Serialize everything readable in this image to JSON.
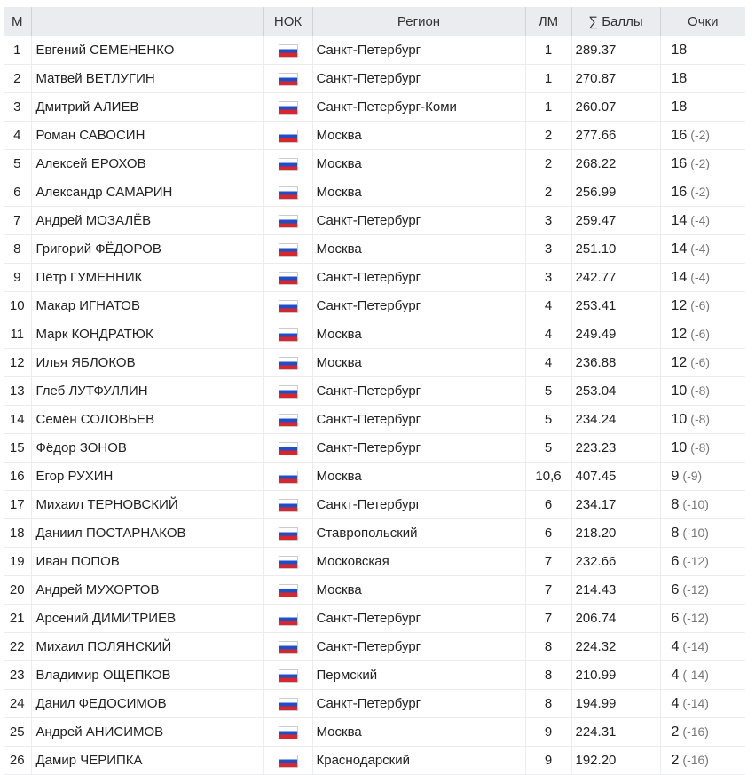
{
  "table": {
    "headers": {
      "m": "М",
      "name": "",
      "noc": "НОК",
      "region": "Регион",
      "lm": "ЛМ",
      "sum": "∑ Баллы",
      "pts": "Очки"
    },
    "flag_icon": "russia-flag-icon",
    "colors": {
      "header_bg": "#eaecf0",
      "flag_white": "#ffffff",
      "flag_blue": "#1f4fc7",
      "flag_red": "#d8262c",
      "delta_text": "#777777"
    },
    "rows": [
      {
        "m": "1",
        "name": "Евгений СЕМЕНЕНКО",
        "region": "Санкт-Петербург",
        "lm": "1",
        "sum": "289.37",
        "pts": "18",
        "delta": ""
      },
      {
        "m": "2",
        "name": "Матвей ВЕТЛУГИН",
        "region": "Санкт-Петербург",
        "lm": "1",
        "sum": "270.87",
        "pts": "18",
        "delta": ""
      },
      {
        "m": "3",
        "name": "Дмитрий АЛИЕВ",
        "region": "Санкт-Петербург-Коми",
        "lm": "1",
        "sum": "260.07",
        "pts": "18",
        "delta": ""
      },
      {
        "m": "4",
        "name": "Роман САВОСИН",
        "region": "Москва",
        "lm": "2",
        "sum": "277.66",
        "pts": "16",
        "delta": "(-2)"
      },
      {
        "m": "5",
        "name": "Алексей ЕРОХОВ",
        "region": "Москва",
        "lm": "2",
        "sum": "268.22",
        "pts": "16",
        "delta": "(-2)"
      },
      {
        "m": "6",
        "name": "Александр САМАРИН",
        "region": "Москва",
        "lm": "2",
        "sum": "256.99",
        "pts": "16",
        "delta": "(-2)"
      },
      {
        "m": "7",
        "name": "Андрей МОЗАЛЁВ",
        "region": "Санкт-Петербург",
        "lm": "3",
        "sum": "259.47",
        "pts": "14",
        "delta": "(-4)"
      },
      {
        "m": "8",
        "name": "Григорий ФЁДОРОВ",
        "region": "Москва",
        "lm": "3",
        "sum": "251.10",
        "pts": "14",
        "delta": "(-4)"
      },
      {
        "m": "9",
        "name": "Пётр ГУМЕННИК",
        "region": "Санкт-Петербург",
        "lm": "3",
        "sum": "242.77",
        "pts": "14",
        "delta": "(-4)"
      },
      {
        "m": "10",
        "name": "Макар ИГНАТОВ",
        "region": "Санкт-Петербург",
        "lm": "4",
        "sum": "253.41",
        "pts": "12",
        "delta": "(-6)"
      },
      {
        "m": "11",
        "name": "Марк КОНДРАТЮК",
        "region": "Москва",
        "lm": "4",
        "sum": "249.49",
        "pts": "12",
        "delta": "(-6)"
      },
      {
        "m": "12",
        "name": "Илья ЯБЛОКОВ",
        "region": "Москва",
        "lm": "4",
        "sum": "236.88",
        "pts": "12",
        "delta": "(-6)"
      },
      {
        "m": "13",
        "name": "Глеб ЛУТФУЛЛИН",
        "region": "Санкт-Петербург",
        "lm": "5",
        "sum": "253.04",
        "pts": "10",
        "delta": "(-8)"
      },
      {
        "m": "14",
        "name": "Семён СОЛОВЬЕВ",
        "region": "Санкт-Петербург",
        "lm": "5",
        "sum": "234.24",
        "pts": "10",
        "delta": "(-8)"
      },
      {
        "m": "15",
        "name": "Фёдор ЗОНОВ",
        "region": "Санкт-Петербург",
        "lm": "5",
        "sum": "223.23",
        "pts": "10",
        "delta": "(-8)"
      },
      {
        "m": "16",
        "name": "Егор РУХИН",
        "region": "Москва",
        "lm": "10,6",
        "sum": "407.45",
        "pts": "9",
        "delta": "(-9)"
      },
      {
        "m": "17",
        "name": "Михаил ТЕРНОВСКИЙ",
        "region": "Санкт-Петербург",
        "lm": "6",
        "sum": "234.17",
        "pts": "8",
        "delta": "(-10)"
      },
      {
        "m": "18",
        "name": "Даниил ПОСТАРНАКОВ",
        "region": "Ставропольский",
        "lm": "6",
        "sum": "218.20",
        "pts": "8",
        "delta": "(-10)"
      },
      {
        "m": "19",
        "name": "Иван ПОПОВ",
        "region": "Московская",
        "lm": "7",
        "sum": "232.66",
        "pts": "6",
        "delta": "(-12)"
      },
      {
        "m": "20",
        "name": "Андрей МУХОРТОВ",
        "region": "Москва",
        "lm": "7",
        "sum": "214.43",
        "pts": "6",
        "delta": "(-12)"
      },
      {
        "m": "21",
        "name": "Арсений ДИМИТРИЕВ",
        "region": "Санкт-Петербург",
        "lm": "7",
        "sum": "206.74",
        "pts": "6",
        "delta": "(-12)"
      },
      {
        "m": "22",
        "name": "Михаил ПОЛЯНСКИЙ",
        "region": "Санкт-Петербург",
        "lm": "8",
        "sum": "224.32",
        "pts": "4",
        "delta": "(-14)"
      },
      {
        "m": "23",
        "name": "Владимир ОЩЕПКОВ",
        "region": "Пермский",
        "lm": "8",
        "sum": "210.99",
        "pts": "4",
        "delta": "(-14)"
      },
      {
        "m": "24",
        "name": "Данил ФЕДОСИМОВ",
        "region": "Санкт-Петербург",
        "lm": "8",
        "sum": "194.99",
        "pts": "4",
        "delta": "(-14)"
      },
      {
        "m": "25",
        "name": "Андрей АНИСИМОВ",
        "region": "Москва",
        "lm": "9",
        "sum": "224.31",
        "pts": "2",
        "delta": "(-16)"
      },
      {
        "m": "26",
        "name": "Дамир ЧЕРИПКА",
        "region": "Краснодарский",
        "lm": "9",
        "sum": "192.20",
        "pts": "2",
        "delta": "(-16)"
      }
    ]
  }
}
